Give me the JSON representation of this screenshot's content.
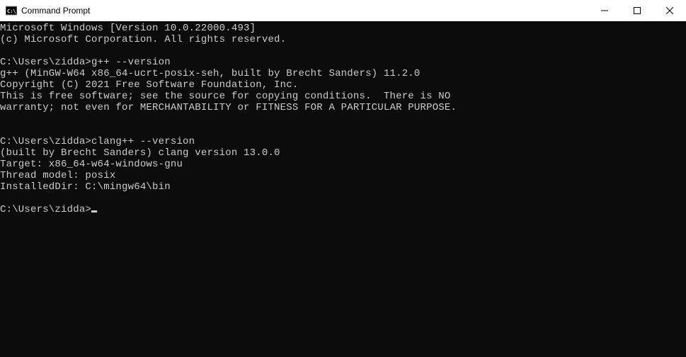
{
  "window": {
    "title": "Command Prompt"
  },
  "terminal": {
    "lines": [
      "Microsoft Windows [Version 10.0.22000.493]",
      "(c) Microsoft Corporation. All rights reserved.",
      "",
      "C:\\Users\\zidda>g++ --version",
      "g++ (MinGW-W64 x86_64-ucrt-posix-seh, built by Brecht Sanders) 11.2.0",
      "Copyright (C) 2021 Free Software Foundation, Inc.",
      "This is free software; see the source for copying conditions.  There is NO",
      "warranty; not even for MERCHANTABILITY or FITNESS FOR A PARTICULAR PURPOSE.",
      "",
      "",
      "C:\\Users\\zidda>clang++ --version",
      "(built by Brecht Sanders) clang version 13.0.0",
      "Target: x86_64-w64-windows-gnu",
      "Thread model: posix",
      "InstalledDir: C:\\mingw64\\bin",
      "",
      "C:\\Users\\zidda>"
    ],
    "prompt_cursor_on_last": true
  }
}
